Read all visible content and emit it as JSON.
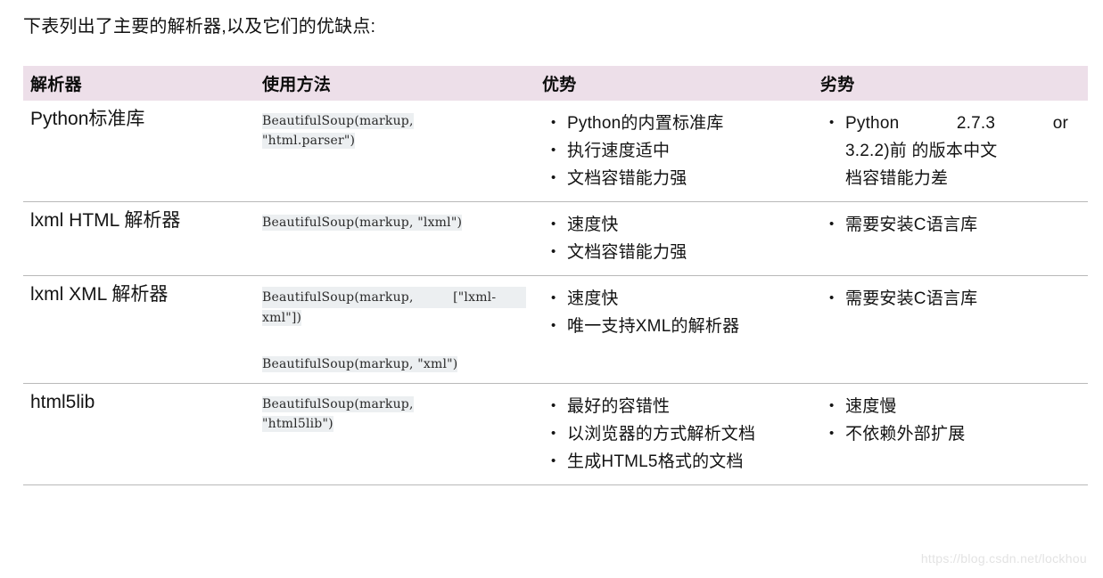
{
  "intro": "下表列出了主要的解析器,以及它们的优缺点:",
  "watermark": "https://blog.csdn.net/lockhou",
  "colors": {
    "header_band": "#eddfe9",
    "row_rule": "#b9b9b9",
    "code_bg": "#eceff1",
    "text": "#131313",
    "watermark": "#e3e3e3"
  },
  "table": {
    "headers": {
      "parser": "解析器",
      "usage": "使用方法",
      "pros": "优势",
      "cons": "劣势"
    },
    "rows": [
      {
        "parser": "Python标准库",
        "code": [
          {
            "line1": "BeautifulSoup(markup,",
            "line2": "\"html.parser\")"
          }
        ],
        "pros": [
          "Python的内置标准库",
          "执行速度适中",
          "文档容错能力强"
        ],
        "cons_justified": {
          "line1_left": "Python",
          "line1_mid": "2.7.3",
          "line1_right": "or",
          "line2": "3.2.2)前 的版本中文",
          "line3": "档容错能力差"
        }
      },
      {
        "parser": "lxml HTML 解析器",
        "code": [
          {
            "line1": "BeautifulSoup(markup, \"lxml\")",
            "line2": ""
          }
        ],
        "pros": [
          "速度快",
          "文档容错能力强"
        ],
        "cons": [
          "需要安装C语言库"
        ]
      },
      {
        "parser": "lxml XML 解析器",
        "code": [
          {
            "line1_left": "BeautifulSoup(markup,",
            "line1_right": "[\"lxml-",
            "line2": "xml\"])"
          },
          {
            "line1": "BeautifulSoup(markup, \"xml\")",
            "line2": ""
          }
        ],
        "pros": [
          "速度快",
          "唯一支持XML的解析器"
        ],
        "cons": [
          "需要安装C语言库"
        ]
      },
      {
        "parser": "html5lib",
        "code": [
          {
            "line1": "BeautifulSoup(markup,",
            "line2": "\"html5lib\")"
          }
        ],
        "pros": [
          "最好的容错性",
          "以浏览器的方式解析文档",
          "生成HTML5格式的文档"
        ],
        "cons": [
          "速度慢",
          "不依赖外部扩展"
        ]
      }
    ]
  }
}
